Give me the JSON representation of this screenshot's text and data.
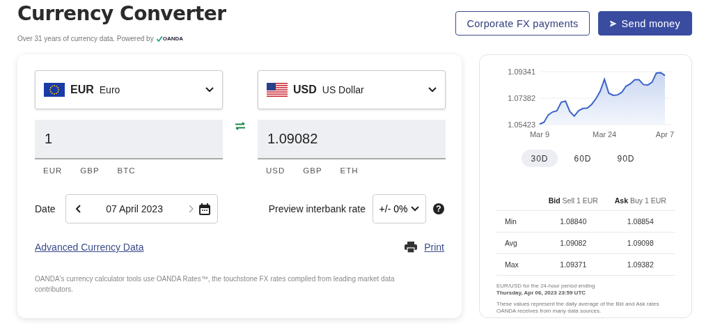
{
  "header": {
    "title": "Currency Converter",
    "subtitle": "Over 31 years of currency data. Powered by",
    "logo": "OANDA"
  },
  "actions": [
    {
      "label": "Corporate FX payments",
      "kind": "outline"
    },
    {
      "label": "Send money",
      "kind": "primary"
    }
  ],
  "converter": {
    "currencies": [
      {
        "code": "EUR",
        "name": "Euro",
        "amount": "1",
        "quick": [
          "EUR",
          "GBP",
          "BTC"
        ]
      },
      {
        "code": "USD",
        "name": "US Dollar",
        "amount": "1.09082",
        "quick": [
          "USD",
          "GBP",
          "ETH"
        ]
      }
    ],
    "date": {
      "label": "Date",
      "value": "07 April 2023",
      "next_disabled": true
    },
    "rate": {
      "label": "Preview interbank rate",
      "value": "+/- 0%",
      "help": "?"
    },
    "advanced_link": "Advanced Currency Data",
    "print_link": "Print",
    "disclaimer": "OANDA's currency calculator tools use OANDA Rates™, the touchstone FX rates compiled from leading market data contributors."
  },
  "rates_panel": {
    "chart_data": {
      "type": "area",
      "categories": [
        "Mar 9",
        null,
        null,
        null,
        null,
        null,
        null,
        null,
        null,
        null,
        null,
        null,
        null,
        null,
        null,
        "Mar 24",
        null,
        null,
        null,
        null,
        null,
        null,
        null,
        null,
        null,
        null,
        null,
        null,
        null,
        "Apr 7"
      ],
      "series": [
        {
          "color": "#3b63c8",
          "values": [
            1.0546,
            1.0559,
            1.0614,
            1.0636,
            1.0645,
            1.0708,
            1.0716,
            1.0639,
            1.0605,
            1.0645,
            1.0662,
            1.0665,
            1.0691,
            1.0733,
            1.0788,
            1.0878,
            1.0776,
            1.0759,
            1.0762,
            1.0781,
            1.0827,
            1.0844,
            1.0875,
            1.0875,
            1.0839,
            1.0835,
            1.0856,
            1.0924,
            1.0927,
            1.0907
          ]
        }
      ],
      "yticks": [
        1.05423,
        1.07382,
        1.09341
      ],
      "ylim": [
        1.05423,
        1.09341
      ]
    },
    "ranges": [
      {
        "label": "30D",
        "selected": true
      },
      {
        "label": "60D",
        "selected": false
      },
      {
        "label": "90D",
        "selected": false
      }
    ],
    "columns": [
      "**Bid** Sell 1 EUR",
      "**Ask** Buy 1 EUR"
    ],
    "rows": [
      {
        "label": "Min",
        "bid": "1.08840",
        "ask": "1.08854"
      },
      {
        "label": "Avg",
        "bid": "1.09082",
        "ask": "1.09098"
      },
      {
        "label": "Max",
        "bid": "1.09371",
        "ask": "1.09382"
      }
    ],
    "period": "EUR/USD for the 24-hour period ending",
    "period_end": "Thursday, Apr 06, 2023 23:59 UTC",
    "note": "These values represent the daily average of the Bid and Ask rates OANDA receives from many data sources."
  }
}
